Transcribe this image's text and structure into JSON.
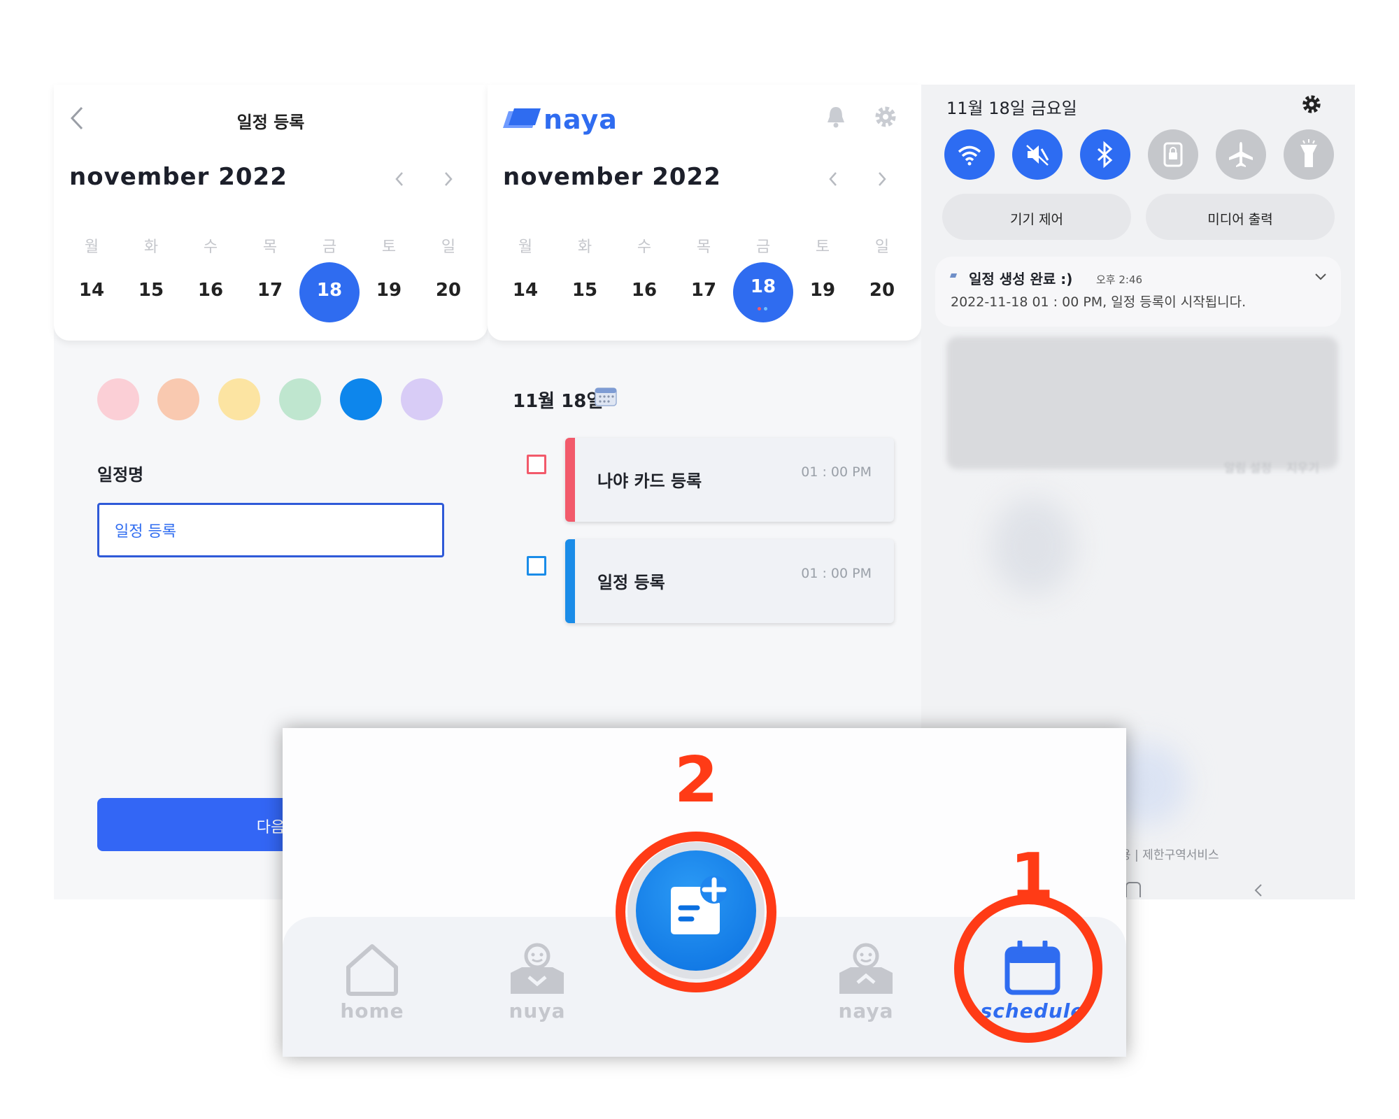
{
  "colors": {
    "accent": "#2f6cf0",
    "annotation": "#ff3b16",
    "swatches": [
      "#fbcfd6",
      "#f9c9b0",
      "#fce4a2",
      "#bfe6cf",
      "#0d86ec",
      "#d8ccf6"
    ],
    "card_bars": [
      "#f25a6b",
      "#1a8ce8"
    ]
  },
  "form_screen": {
    "header_title": "일정 등록",
    "month_title": "november 2022",
    "prev_icon": "chevron-left",
    "next_icon": "chevron-right",
    "weekdays": [
      "월",
      "화",
      "수",
      "목",
      "금",
      "토",
      "일"
    ],
    "days": [
      "14",
      "15",
      "16",
      "17",
      "18",
      "19",
      "20"
    ],
    "selected_day": "18",
    "field_label": "일정명",
    "field_value": "일정 등록",
    "next_button": "다음"
  },
  "schedule_screen": {
    "logo": "naya",
    "month_title": "november 2022",
    "weekdays": [
      "월",
      "화",
      "수",
      "목",
      "금",
      "토",
      "일"
    ],
    "days": [
      "14",
      "15",
      "16",
      "17",
      "18",
      "19",
      "20"
    ],
    "selected_day": "18",
    "date_heading": "11월 18일",
    "items": [
      {
        "title": "나야 카드 등록",
        "time": "01 : 00 PM"
      },
      {
        "title": "일정 등록",
        "time": "01 : 00 PM"
      }
    ]
  },
  "notification_shade": {
    "date": "11월 18일 금요일",
    "quick_settings": [
      {
        "icon": "wifi-icon",
        "on": true
      },
      {
        "icon": "mute-icon",
        "on": true
      },
      {
        "icon": "bluetooth-icon",
        "on": true
      },
      {
        "icon": "lock-icon",
        "on": false
      },
      {
        "icon": "airplane-icon",
        "on": false
      },
      {
        "icon": "flashlight-icon",
        "on": false
      }
    ],
    "device_control": "기기 제어",
    "media_output": "미디어 출력",
    "notification": {
      "title": "일정 생성 완료 :)",
      "time": "오후 2:46",
      "body": "2022-11-18  01 : 00 PM, 일정 등록이 시작됩니다."
    },
    "blurred_actions": [
      "알림 설정",
      "지우기"
    ],
    "footer_text": "용 | 제한구역서비스"
  },
  "bottom_nav": {
    "items": [
      {
        "label": "home",
        "icon": "home-icon"
      },
      {
        "label": "nuya",
        "icon": "nuya-icon"
      },
      {
        "label": "",
        "icon": "add-schedule-icon"
      },
      {
        "label": "naya",
        "icon": "naya-icon"
      },
      {
        "label": "schedule",
        "icon": "calendar-icon"
      }
    ],
    "annotation_1": "1",
    "annotation_2": "2"
  }
}
